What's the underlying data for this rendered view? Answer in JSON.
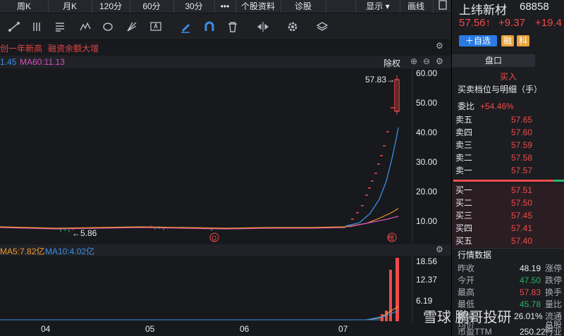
{
  "period_tabs": [
    "周K",
    "月K",
    "120分",
    "60分",
    "30分",
    "•••",
    "个股资料",
    "诊股",
    "显示",
    "画线"
  ],
  "signals": [
    "创一年新高",
    "融资余额大增"
  ],
  "ma_line": {
    "prefix": "1.45",
    "ma60": "MA60:11.13",
    "chuquan": "除权"
  },
  "price_axis": [
    "60.00",
    "50.00",
    "40.00",
    "30.00",
    "20.00",
    "10.00"
  ],
  "annotations": {
    "high": "57.83→",
    "low": "←5.86",
    "q_badge": "Q",
    "bang_badge": "榜"
  },
  "vol_line": {
    "ma5": "MA5:7.82亿",
    "ma10": "MA10:4.02亿"
  },
  "vol_axis": [
    "18.56",
    "12.37",
    "6.19"
  ],
  "x_axis": [
    "04",
    "05",
    "06",
    "07"
  ],
  "watermark": "雪球 鹏哥投研",
  "stock": {
    "name": "上纬新材",
    "code": "68858",
    "price": "57.56↑",
    "change": "+9.37",
    "pct": "+19.4"
  },
  "buttons": {
    "add": "＋自选",
    "rong": "融",
    "ke": "科"
  },
  "panel": {
    "tab": "盘口",
    "buy_label": "买入",
    "detail_title": "买卖档位与明细（手）",
    "webi_label": "委比",
    "webi_value": "+54.46%",
    "asks": [
      {
        "label": "卖五",
        "price": "57.65"
      },
      {
        "label": "卖四",
        "price": "57.60"
      },
      {
        "label": "卖三",
        "price": "57.59"
      },
      {
        "label": "卖二",
        "price": "57.58"
      },
      {
        "label": "卖一",
        "price": "57.57"
      }
    ],
    "bids": [
      {
        "label": "买一",
        "price": "57.51"
      },
      {
        "label": "买二",
        "price": "57.50"
      },
      {
        "label": "买三",
        "price": "57.45"
      },
      {
        "label": "买四",
        "price": "57.41"
      },
      {
        "label": "买五",
        "price": "57.40"
      }
    ],
    "quote_title": "行情数据",
    "quotes": [
      {
        "label": "昨收",
        "value": "48.19",
        "right": "涨停"
      },
      {
        "label": "今开",
        "value": "47.50",
        "right": "跌停"
      },
      {
        "label": "最高",
        "value": "57.83",
        "right": "换手"
      },
      {
        "label": "最低",
        "value": "45.78",
        "right": "量比"
      },
      {
        "label": "振幅",
        "value": "26.01%",
        "right": "流通股"
      },
      {
        "label": "均价",
        "value": "",
        "right": "总股本"
      },
      {
        "label": "市盈TTM",
        "value": "250.22",
        "right": "行业"
      }
    ]
  },
  "colors": {
    "up": "#ef4b4b",
    "down": "#2fb36a",
    "ma_blue": "#3c8fe6",
    "ma_orange": "#f09a2a",
    "ma_pink": "#d84ec0",
    "bg": "#17191d"
  }
}
